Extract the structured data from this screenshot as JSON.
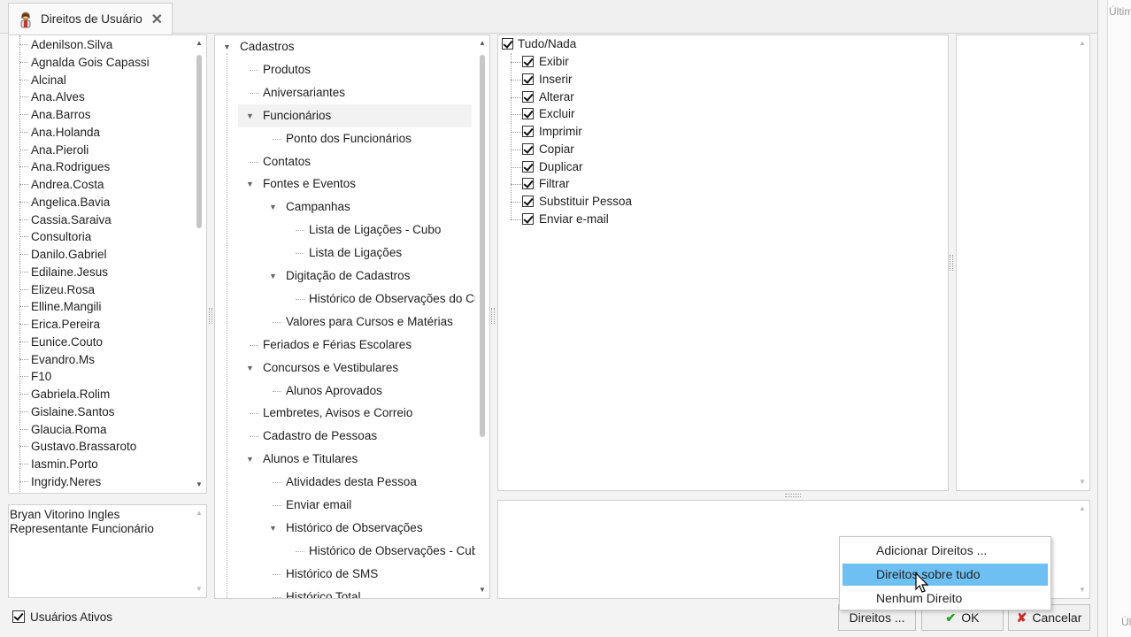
{
  "tab": {
    "title": "Direitos de Usuário",
    "close": "✕",
    "icon": "user-key-icon"
  },
  "side": {
    "top_text": "Últim",
    "bottom_text": "Últ"
  },
  "users": [
    "Adenilson.Silva",
    "Agnalda Gois Capassi",
    "Alcinal",
    "Ana.Alves",
    "Ana.Barros",
    "Ana.Holanda",
    "Ana.Pieroli",
    "Ana.Rodrigues",
    "Andrea.Costa",
    "Angelica.Bavia",
    "Cassia.Saraiva",
    "Consultoria",
    "Danilo.Gabriel",
    "Edilaine.Jesus",
    "Elizeu.Rosa",
    "Elline.Mangili",
    "Erica.Pereira",
    "Eunice.Couto",
    "Evandro.Ms",
    "F10",
    "Gabriela.Rolim",
    "Gislaine.Santos",
    "Glaucia.Roma",
    "Gustavo.Brassaroto",
    "Iasmin.Porto",
    "Ingridy.Neres"
  ],
  "user_info": {
    "name": "Bryan Vitorino Ingles",
    "role": "Representante Funcionário"
  },
  "active_users": {
    "label": "Usuários Ativos",
    "checked": true
  },
  "tree": [
    {
      "label": "Cadastros",
      "level": 0,
      "expanded": true
    },
    {
      "label": "Produtos",
      "level": 1
    },
    {
      "label": "Aniversariantes",
      "level": 1
    },
    {
      "label": "Funcionários",
      "level": 1,
      "expanded": true,
      "highlighted": true
    },
    {
      "label": "Ponto dos Funcionários",
      "level": 2
    },
    {
      "label": "Contatos",
      "level": 1
    },
    {
      "label": "Fontes e Eventos",
      "level": 1,
      "expanded": true
    },
    {
      "label": "Campanhas",
      "level": 2,
      "expanded": true
    },
    {
      "label": "Lista de Ligações - Cubo",
      "level": 3
    },
    {
      "label": "Lista de Ligações",
      "level": 3
    },
    {
      "label": "Digitação de Cadastros",
      "level": 2,
      "expanded": true
    },
    {
      "label": "Histórico de Observações do Cu",
      "level": 3
    },
    {
      "label": "Valores para Cursos e Matérias",
      "level": 2
    },
    {
      "label": "Feriados e Férias Escolares",
      "level": 1
    },
    {
      "label": "Concursos e Vestibulares",
      "level": 1,
      "expanded": true
    },
    {
      "label": "Alunos Aprovados",
      "level": 2
    },
    {
      "label": "Lembretes, Avisos e Correio",
      "level": 1
    },
    {
      "label": "Cadastro de Pessoas",
      "level": 1
    },
    {
      "label": "Alunos e Titulares",
      "level": 1,
      "expanded": true
    },
    {
      "label": "Atividades desta Pessoa",
      "level": 2
    },
    {
      "label": "Enviar email",
      "level": 2
    },
    {
      "label": "Histórico de Observações",
      "level": 2,
      "expanded": true
    },
    {
      "label": "Histórico de Observações - Cub",
      "level": 3
    },
    {
      "label": "Histórico de SMS",
      "level": 2
    },
    {
      "label": "Histórico Total",
      "level": 2
    }
  ],
  "permissions": {
    "all": {
      "label": "Tudo/Nada",
      "checked": true
    },
    "items": [
      {
        "label": "Exibir",
        "checked": true
      },
      {
        "label": "Inserir",
        "checked": true
      },
      {
        "label": "Alterar",
        "checked": true
      },
      {
        "label": "Excluir",
        "checked": true
      },
      {
        "label": "Imprimir",
        "checked": true
      },
      {
        "label": "Copiar",
        "checked": true
      },
      {
        "label": "Duplicar",
        "checked": true
      },
      {
        "label": "Filtrar",
        "checked": true
      },
      {
        "label": "Substituir Pessoa",
        "checked": true
      },
      {
        "label": "Enviar e-mail",
        "checked": true
      }
    ]
  },
  "context_menu": {
    "items": [
      "Adicionar Direitos ...",
      "Direitos sobre tudo",
      "Nenhum Direito"
    ],
    "selected_index": 1
  },
  "buttons": {
    "rights": "Direitos ...",
    "ok": "OK",
    "cancel": "Cancelar"
  }
}
